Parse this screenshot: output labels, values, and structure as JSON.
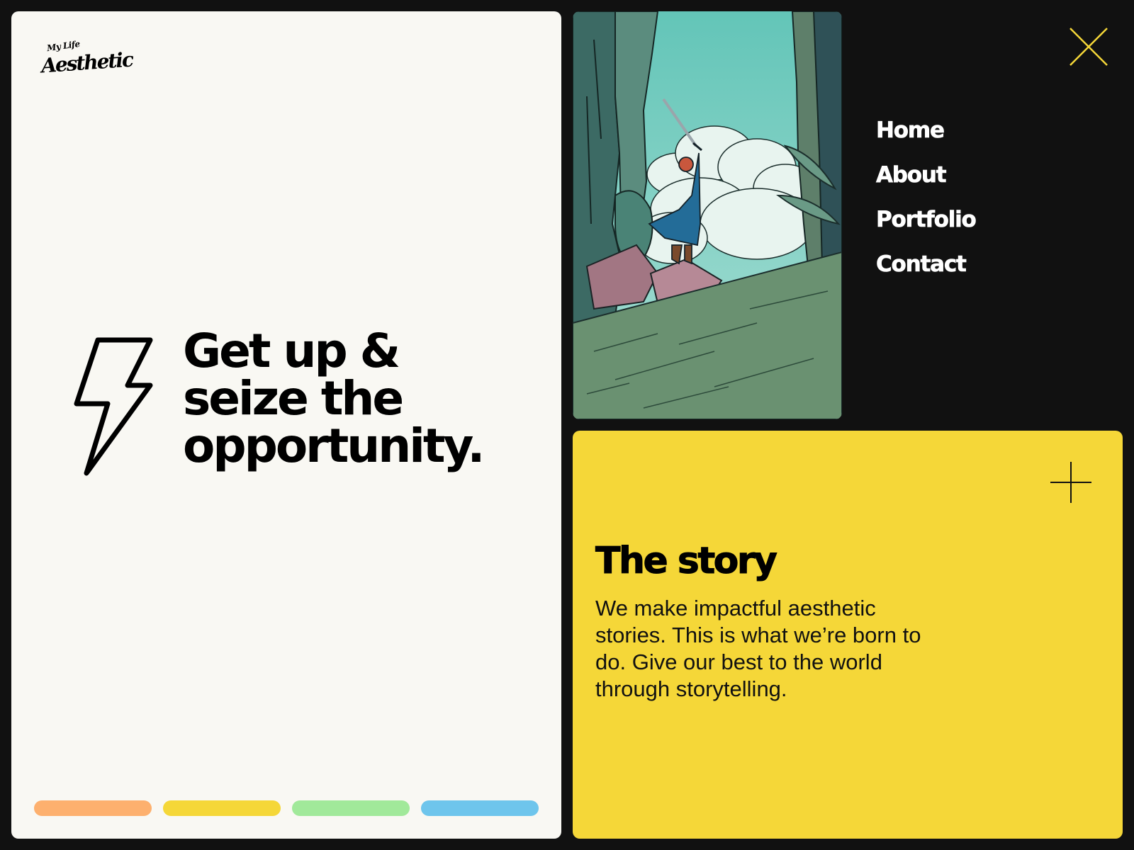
{
  "brand": {
    "logo_small": "My Life",
    "logo_big": "Aesthetic"
  },
  "hero": {
    "headline_lines": [
      "Get up &",
      "seize the",
      "opportunity."
    ],
    "icon": "lightning-bolt-icon"
  },
  "color_bars": [
    {
      "color": "#fdb06e"
    },
    {
      "color": "#f5d738"
    },
    {
      "color": "#a1e99a"
    },
    {
      "color": "#6ec5ec"
    }
  ],
  "nav": {
    "items": [
      {
        "label": "Home"
      },
      {
        "label": "About"
      },
      {
        "label": "Portfolio"
      },
      {
        "label": "Contact"
      }
    ],
    "close_icon": "close-icon"
  },
  "story": {
    "title": "The story",
    "body": "We make impactful aesthetic stories. This is what we’re born to do. Give our best to the world through storytelling.",
    "expand_icon": "plus-icon"
  },
  "colors": {
    "background": "#111111",
    "panel": "#f9f8f3",
    "accent_yellow": "#f5d738",
    "close_stroke": "#f5d738"
  }
}
